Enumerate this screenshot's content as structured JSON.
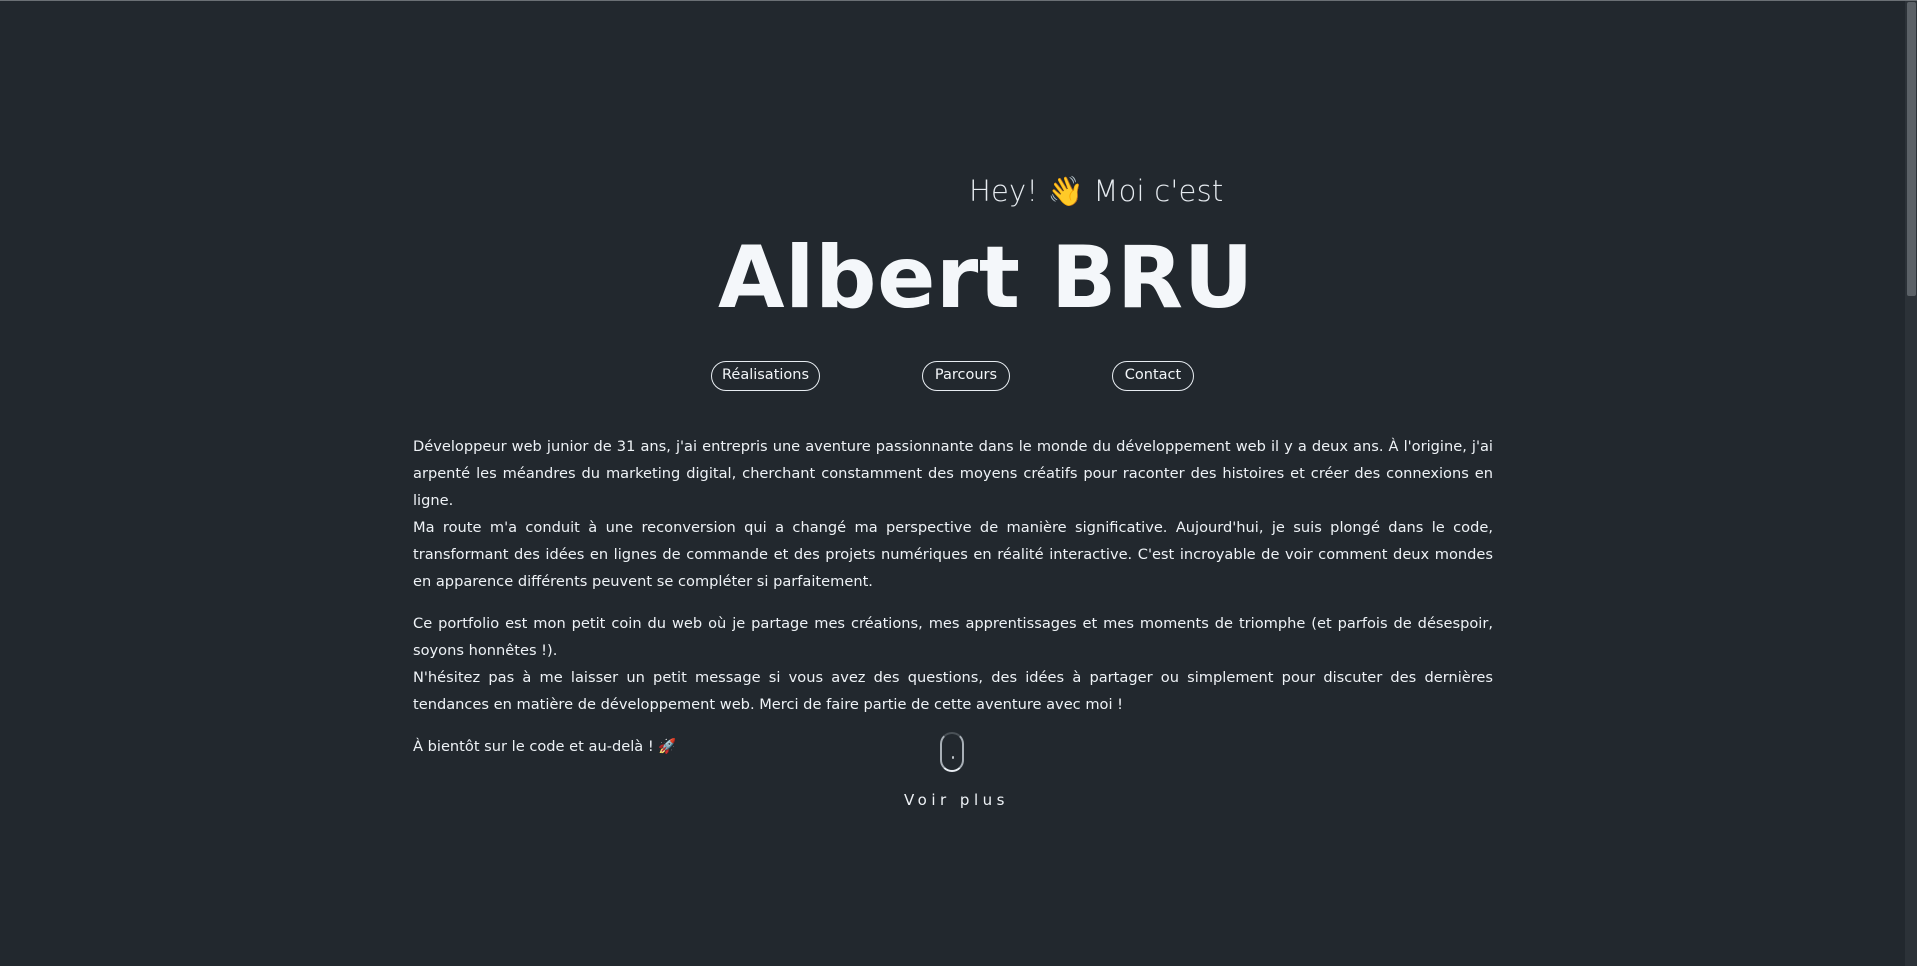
{
  "hero": {
    "greeting": "Hey! 👋 Moi c'est",
    "name": "Albert BRU"
  },
  "nav": {
    "items": [
      {
        "label": "Réalisations"
      },
      {
        "label": "Parcours"
      },
      {
        "label": "Contact"
      }
    ]
  },
  "about": {
    "paragraphs": [
      [
        "Développeur web junior de 31 ans, j'ai entrepris une aventure passionnante dans le monde du développement web il y a deux ans. À l'origine, j'ai arpenté les méandres du marketing digital, cherchant constamment des moyens créatifs pour raconter des histoires et créer des connexions en ligne.",
        "Ma route m'a conduit à une reconversion qui a changé ma perspective de manière significative. Aujourd'hui, je suis plongé dans le code, transformant des idées en lignes de commande et des projets numériques en réalité interactive. C'est incroyable de voir comment deux mondes en apparence différents peuvent se compléter si parfaitement."
      ],
      [
        "Ce portfolio est mon petit coin du web où je partage mes créations, mes apprentissages et mes moments de triomphe (et parfois de désespoir, soyons honnêtes !).",
        "N'hésitez pas à me laisser un petit message si vous avez des questions, des idées à partager ou simplement pour discuter des dernières tendances en matière de développement web. Merci de faire partie de cette aventure avec moi !"
      ],
      [
        "À bientôt sur le code et au-delà ! 🚀"
      ]
    ]
  },
  "scroll": {
    "label": "Voir plus",
    "icon": "mouse-scroll-icon"
  },
  "colors": {
    "background": "#22282e",
    "text": "#eef2f6"
  }
}
